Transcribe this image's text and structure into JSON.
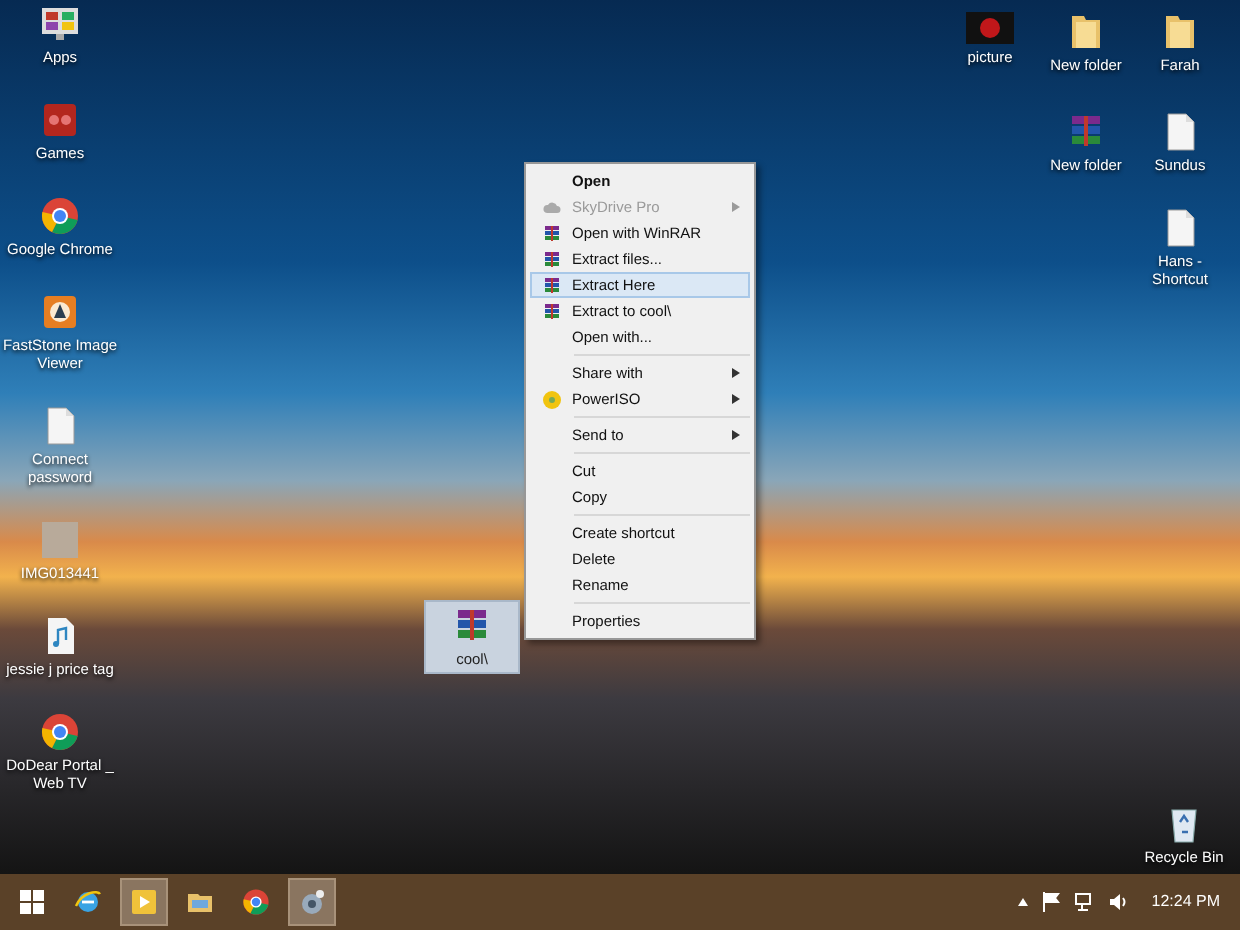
{
  "desktop": {
    "left_icons": [
      {
        "label": "Apps",
        "kind": "apps"
      },
      {
        "label": "Games",
        "kind": "games"
      },
      {
        "label": "Google Chrome",
        "kind": "chrome"
      },
      {
        "label": "FastStone Image Viewer",
        "kind": "viewer"
      },
      {
        "label": "Connect password",
        "kind": "document"
      },
      {
        "label": "IMG013441",
        "kind": "photo"
      },
      {
        "label": "jessie j price tag",
        "kind": "audio"
      },
      {
        "label": "DoDear Portal _ Web TV",
        "kind": "chrome"
      }
    ],
    "right_icons": [
      {
        "label": "picture",
        "kind": "picture"
      },
      {
        "label": "New folder",
        "kind": "folder"
      },
      {
        "label": "Farah",
        "kind": "folder"
      },
      {
        "label": "New folder",
        "kind": "winrar"
      },
      {
        "label": "Sundus",
        "kind": "document"
      },
      {
        "label": "Hans - Shortcut",
        "kind": "document"
      }
    ],
    "selected_file": {
      "label": "cool\\",
      "kind": "winrar",
      "selected": true
    },
    "recycle_bin": {
      "label": "Recycle Bin",
      "kind": "recycle"
    }
  },
  "context_menu": [
    [
      {
        "label": "Open",
        "bold": true,
        "disabled": false,
        "submenu": false,
        "selected": false
      },
      {
        "label": "SkyDrive Pro",
        "kind": "cloud",
        "bold": false,
        "disabled": true,
        "submenu": true,
        "selected": false
      },
      {
        "label": "Open with WinRAR",
        "kind": "winrar",
        "bold": false,
        "disabled": false,
        "submenu": false,
        "selected": false
      },
      {
        "label": "Extract files...",
        "kind": "winrar",
        "bold": false,
        "disabled": false,
        "submenu": false,
        "selected": false
      },
      {
        "label": "Extract Here",
        "kind": "winrar",
        "bold": false,
        "disabled": false,
        "submenu": false,
        "selected": true
      },
      {
        "label": "Extract to cool\\",
        "kind": "winrar",
        "bold": false,
        "disabled": false,
        "submenu": false,
        "selected": false
      },
      {
        "label": "Open with...",
        "bold": false,
        "disabled": false,
        "submenu": false,
        "selected": false
      }
    ],
    [
      {
        "label": "Share with",
        "bold": false,
        "disabled": false,
        "submenu": true,
        "selected": false
      },
      {
        "label": "PowerISO",
        "kind": "poweriso",
        "bold": false,
        "disabled": false,
        "submenu": true,
        "selected": false
      }
    ],
    [
      {
        "label": "Send to",
        "bold": false,
        "disabled": false,
        "submenu": true,
        "selected": false
      }
    ],
    [
      {
        "label": "Cut",
        "bold": false,
        "disabled": false,
        "submenu": false,
        "selected": false
      },
      {
        "label": "Copy",
        "bold": false,
        "disabled": false,
        "submenu": false,
        "selected": false
      }
    ],
    [
      {
        "label": "Create shortcut",
        "bold": false,
        "disabled": false,
        "submenu": false,
        "selected": false
      },
      {
        "label": "Delete",
        "bold": false,
        "disabled": false,
        "submenu": false,
        "selected": false
      },
      {
        "label": "Rename",
        "bold": false,
        "disabled": false,
        "submenu": false,
        "selected": false
      }
    ],
    [
      {
        "label": "Properties",
        "bold": false,
        "disabled": false,
        "submenu": false,
        "selected": false
      }
    ]
  ],
  "taskbar": {
    "buttons": [
      {
        "kind": "start",
        "active": false
      },
      {
        "kind": "browser",
        "active": false
      },
      {
        "kind": "media",
        "active": true
      },
      {
        "kind": "explorer",
        "active": false
      },
      {
        "kind": "chrome",
        "active": false
      },
      {
        "kind": "app",
        "active": true
      }
    ],
    "clock": "12:24 PM"
  }
}
